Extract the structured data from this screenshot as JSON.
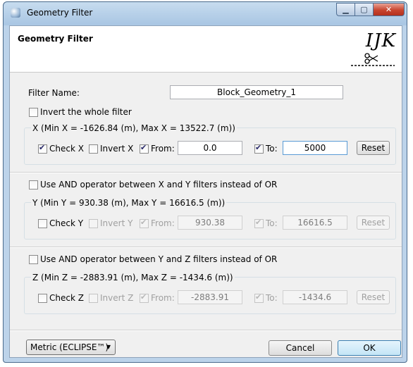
{
  "window": {
    "title": "Geometry Filter",
    "icon": "filter-app-icon"
  },
  "header": {
    "title": "Geometry Filter",
    "logo_text": "IJK"
  },
  "filter_name": {
    "label": "Filter Name:",
    "value": "Block_Geometry_1"
  },
  "invert_whole": {
    "label": "Invert the whole filter",
    "checked": false
  },
  "x": {
    "range_label": "X (Min X = -1626.84 (m), Max X = 13522.7 (m))",
    "check_label": "Check X",
    "check": true,
    "invert_label": "Invert X",
    "invert": false,
    "from_label": "From:",
    "from_checked": true,
    "from_value": "0.0",
    "to_label": "To:",
    "to_checked": true,
    "to_value": "5000",
    "reset": "Reset"
  },
  "and_xy": {
    "label": "Use AND operator between X and Y filters instead of OR",
    "checked": false
  },
  "y": {
    "range_label": "Y (Min Y = 930.38 (m), Max Y = 16616.5 (m))",
    "check_label": "Check Y",
    "check": false,
    "invert_label": "Invert Y",
    "invert": false,
    "from_label": "From:",
    "from_checked": true,
    "from_value": "930.38",
    "to_label": "To:",
    "to_checked": true,
    "to_value": "16616.5",
    "reset": "Reset"
  },
  "and_yz": {
    "label": "Use AND operator between Y and Z filters instead of OR",
    "checked": false
  },
  "z": {
    "range_label": "Z (Min Z = -2883.91 (m), Max Z = -1434.6 (m))",
    "check_label": "Check Z",
    "check": false,
    "invert_label": "Invert Z",
    "invert": false,
    "from_label": "From:",
    "from_checked": true,
    "from_value": "-2883.91",
    "to_label": "To:",
    "to_checked": true,
    "to_value": "-1434.6",
    "reset": "Reset"
  },
  "footer": {
    "units": "Metric (ECLIPSE™)",
    "cancel": "Cancel",
    "ok": "OK"
  }
}
